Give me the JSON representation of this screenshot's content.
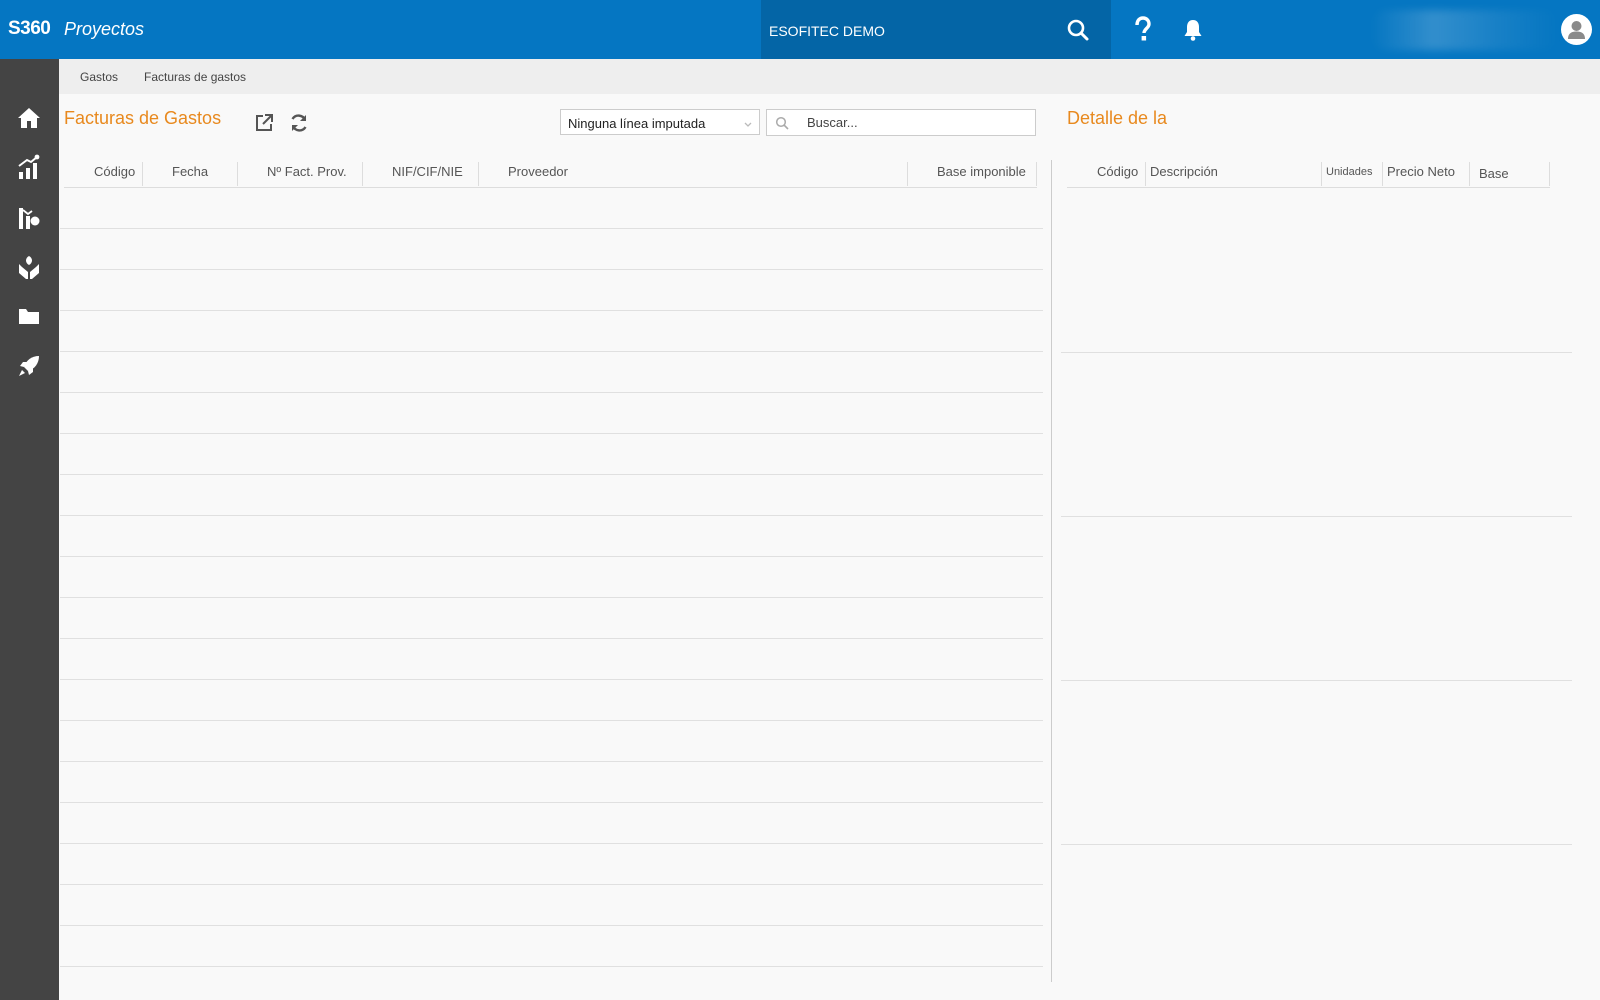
{
  "header": {
    "brand": "S360",
    "module": "Proyectos",
    "company": "ESOFITEC DEMO",
    "accent_color": "#0576c2",
    "icons": [
      "search-icon",
      "help-icon",
      "bell-icon",
      "avatar"
    ]
  },
  "sidebar": {
    "items": [
      {
        "icon": "home-icon"
      },
      {
        "icon": "chart-growth-icon"
      },
      {
        "icon": "analytics-icon"
      },
      {
        "icon": "hands-plant-icon"
      },
      {
        "icon": "folder-icon"
      },
      {
        "icon": "rocket-icon"
      }
    ]
  },
  "breadcrumb": {
    "items": [
      "Gastos",
      "Facturas de gastos"
    ]
  },
  "invoices": {
    "title": "Facturas de Gastos",
    "filter_value": "Ninguna línea imputada",
    "search_placeholder": "Buscar...",
    "columns": [
      "Código",
      "Fecha",
      "Nº Fact. Prov.",
      "NIF/CIF/NIE",
      "Proveedor",
      "Base imponible"
    ],
    "rows": []
  },
  "detail": {
    "title": "Detalle de la",
    "columns": [
      "Código",
      "Descripción",
      "Unidades",
      "Precio Neto",
      "Base"
    ],
    "rows": []
  },
  "colors": {
    "title_orange": "#e8891e",
    "sidebar_bg": "#444444"
  }
}
